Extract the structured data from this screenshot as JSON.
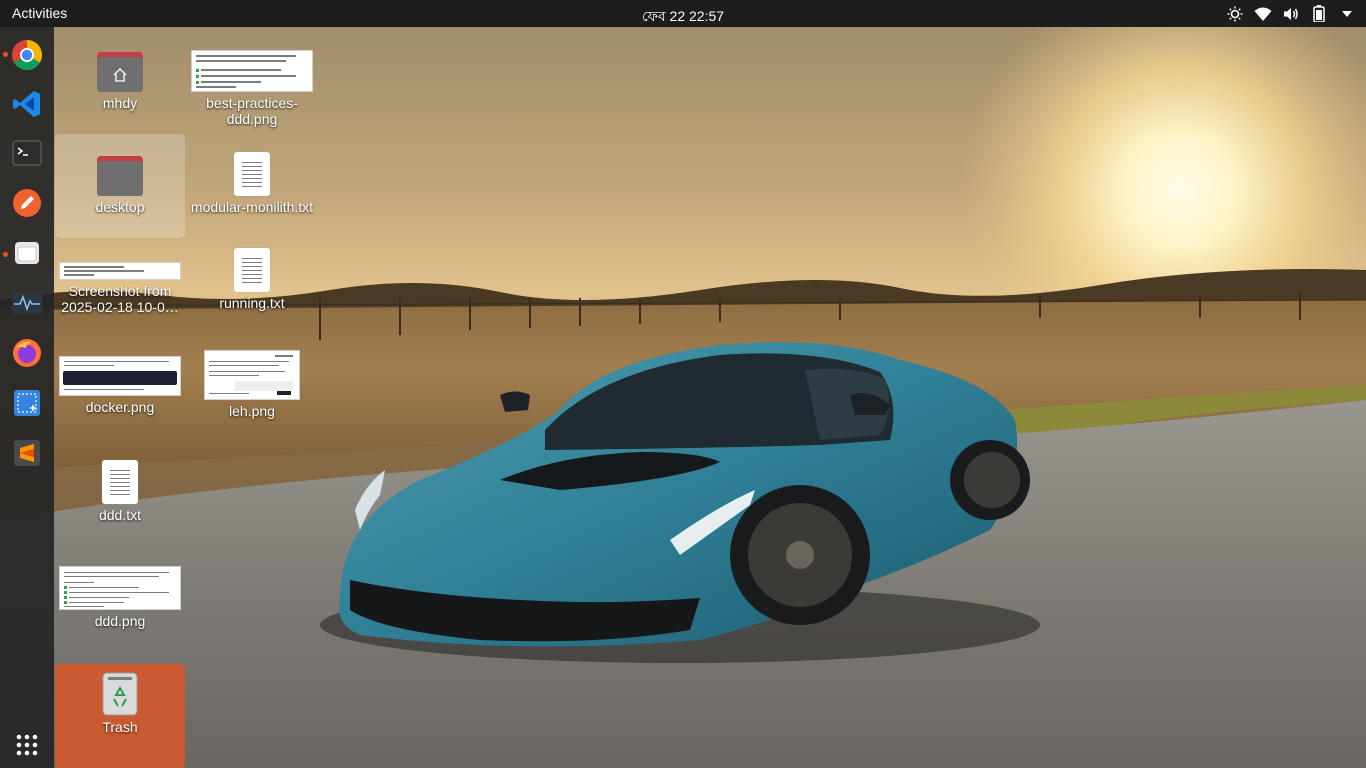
{
  "topbar": {
    "activities_label": "Activities",
    "clock": "ফেব 22  22:57",
    "tray": [
      "brightness-icon",
      "wifi-icon",
      "volume-icon",
      "battery-icon",
      "system-menu-arrow-icon"
    ]
  },
  "dock": {
    "items": [
      {
        "name": "Google Chrome",
        "icon": "chrome-icon",
        "running": true
      },
      {
        "name": "Visual Studio Code",
        "icon": "vscode-icon",
        "running": false
      },
      {
        "name": "Terminal",
        "icon": "terminal-icon",
        "running": false
      },
      {
        "name": "Pen tool",
        "icon": "pen-icon",
        "running": false
      },
      {
        "name": "Files",
        "icon": "files-icon",
        "running": true
      },
      {
        "name": "System Monitor",
        "icon": "system-monitor-icon",
        "running": false
      },
      {
        "name": "Firefox",
        "icon": "firefox-icon",
        "running": false
      },
      {
        "name": "Screenshot",
        "icon": "screenshot-icon",
        "running": false
      },
      {
        "name": "Sublime Text",
        "icon": "sublime-icon",
        "running": false
      }
    ],
    "show_apps_icon": "apps-grid-icon"
  },
  "desktop": {
    "icons": [
      {
        "label": "mhdy",
        "type": "home-folder"
      },
      {
        "label": "best-practices-ddd.png",
        "type": "image"
      },
      {
        "label": "desktop",
        "type": "folder"
      },
      {
        "label": "modular-monilith.txt",
        "type": "text"
      },
      {
        "label": "Screenshot from 2025-02-18 10-0…",
        "type": "image"
      },
      {
        "label": "running.txt",
        "type": "text"
      },
      {
        "label": "docker.png",
        "type": "image"
      },
      {
        "label": "leh.png",
        "type": "image"
      },
      {
        "label": "ddd.txt",
        "type": "text"
      },
      {
        "label": "ddd.png",
        "type": "image"
      },
      {
        "label": "Trash",
        "type": "trash"
      }
    ]
  },
  "colors": {
    "topbar": "#1d1d1d",
    "dock": "#262626",
    "accent": "#e95420",
    "folder_tab": "#c33c4b",
    "folder_body": "#6f6f6f"
  }
}
